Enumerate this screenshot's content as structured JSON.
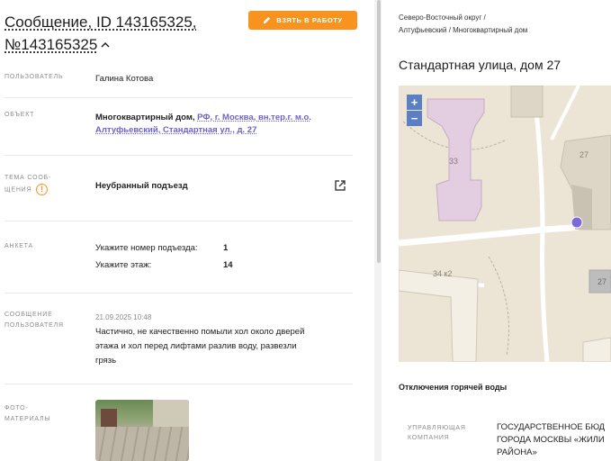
{
  "header": {
    "title_line1": "Сообщение, ID 143165325,",
    "title_line2": "№143165325",
    "collapse_icon": "chevron-up-icon",
    "take_button_label": "ВЗЯТЬ В РАБОТУ",
    "take_button_icon": "pencil-icon",
    "accent_color": "#f7931e"
  },
  "fields": {
    "user_label": "ПОЛЬЗОВАТЕЛЬ",
    "user_value": "Галина Котова",
    "object_label": "ОБЪЕКТ",
    "object_type": "Многоквартирный дом,",
    "object_link": "РФ, г. Москва, вн.тер.г. м.о. Алтуфьевский, Стандартная ул., д. 27",
    "topic_label_1": "ТЕМА СООБ-",
    "topic_label_2": "ЩЕНИЯ",
    "topic_warning_icon": "warning-icon",
    "topic_value": "Неубранный подъезд",
    "topic_open_icon": "external-link-icon",
    "form_label": "АНКЕТА",
    "form_rows": [
      {
        "question": "Укажите номер подъезда:",
        "answer": "1"
      },
      {
        "question": "Укажите этаж:",
        "answer": "14"
      }
    ],
    "message_label_1": "СООБЩЕНИЕ",
    "message_label_2": "ПОЛЬЗОВАТЕЛЯ",
    "message_date": "21.09.2025 10:48",
    "message_text": "Частично, не качественно помыли хол около дверей этажа и хол перед лифтами разлив воду, развезли грязь",
    "photo_label_1": "ФОТО-",
    "photo_label_2": "МАТЕРИАЛЫ"
  },
  "right": {
    "breadcrumb_1": "Северо-Восточный округ /",
    "breadcrumb_2": "Алтуфьевский / Многоквартирный дом",
    "address": "Стандартная улица, дом 27",
    "map": {
      "zoom_in": "+",
      "zoom_out": "−",
      "building_labels": [
        "33",
        "27",
        "34 к2",
        "27"
      ],
      "marker_color": "#7b68d9"
    },
    "section_title": "Отключения горячей воды",
    "uk_label_1": "УПРАВЛЯЮЩАЯ",
    "uk_label_2": "КОМПАНИЯ",
    "uk_value_1": "ГОСУДАРСТВЕННОЕ БЮД",
    "uk_value_2": "ГОРОДА МОСКВЫ «ЖИЛИ",
    "uk_value_3": "РАЙОНА»"
  }
}
